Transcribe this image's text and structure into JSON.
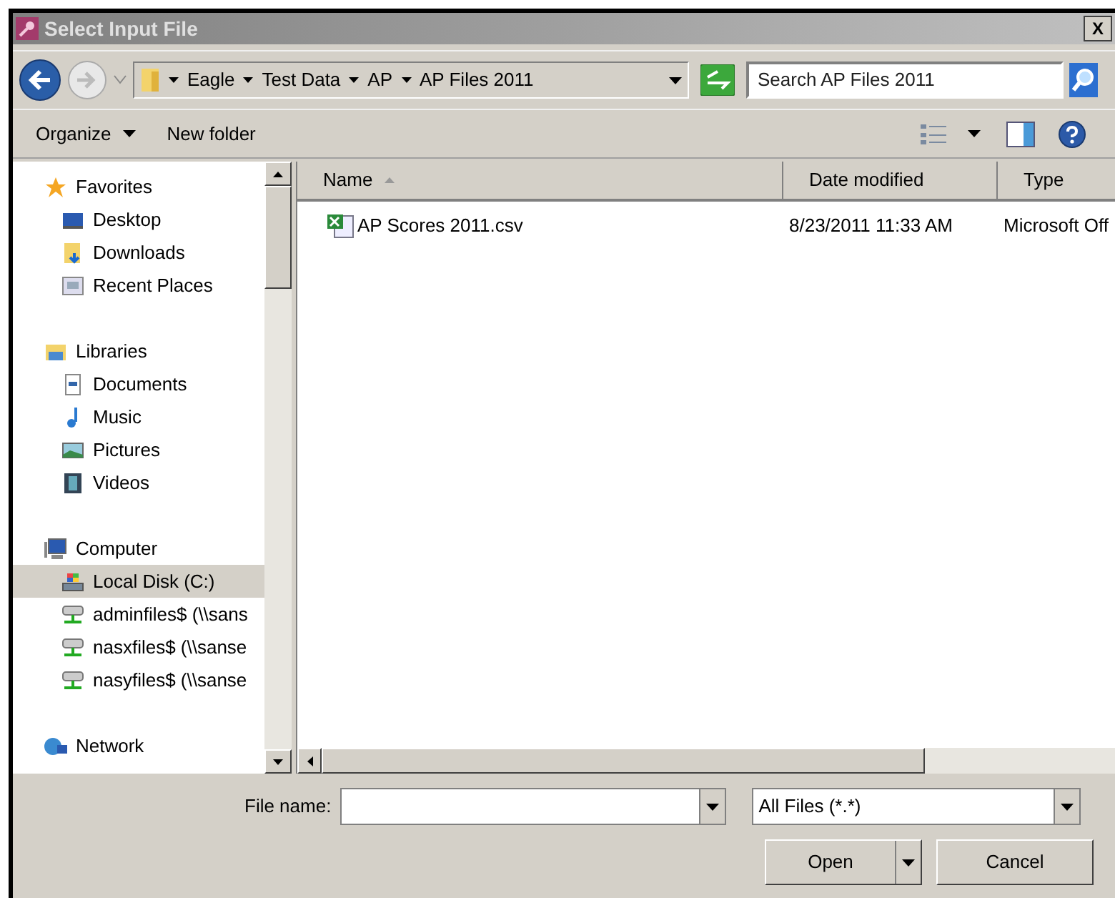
{
  "window": {
    "title": "Select Input File",
    "close_label": "X"
  },
  "address_bar": {
    "breadcrumbs": [
      "Eagle",
      "Test Data",
      "AP",
      "AP Files 2011"
    ]
  },
  "search": {
    "placeholder": "Search AP Files 2011"
  },
  "toolbar": {
    "organize": "Organize",
    "new_folder": "New folder"
  },
  "sidebar": {
    "items": [
      {
        "kind": "header",
        "label": "Favorites",
        "selected": false
      },
      {
        "kind": "item",
        "label": "Desktop",
        "selected": false
      },
      {
        "kind": "item",
        "label": "Downloads",
        "selected": false
      },
      {
        "kind": "item",
        "label": "Recent Places",
        "selected": false
      },
      {
        "kind": "gap"
      },
      {
        "kind": "header",
        "label": "Libraries",
        "selected": false
      },
      {
        "kind": "item",
        "label": "Documents",
        "selected": false
      },
      {
        "kind": "item",
        "label": "Music",
        "selected": false
      },
      {
        "kind": "item",
        "label": "Pictures",
        "selected": false
      },
      {
        "kind": "item",
        "label": "Videos",
        "selected": false
      },
      {
        "kind": "gap"
      },
      {
        "kind": "header",
        "label": "Computer",
        "selected": false
      },
      {
        "kind": "item",
        "label": "Local Disk (C:)",
        "selected": true
      },
      {
        "kind": "item",
        "label": "adminfiles$ (\\\\sans",
        "selected": false
      },
      {
        "kind": "item",
        "label": "nasxfiles$ (\\\\sanse",
        "selected": false
      },
      {
        "kind": "item",
        "label": "nasyfiles$ (\\\\sanse",
        "selected": false
      },
      {
        "kind": "gap"
      },
      {
        "kind": "header",
        "label": "Network",
        "selected": false
      }
    ]
  },
  "table": {
    "columns": [
      {
        "label": "Name",
        "sorted": true
      },
      {
        "label": "Date modified",
        "sorted": false
      },
      {
        "label": "Type",
        "sorted": false
      }
    ],
    "rows": [
      {
        "name": "AP Scores 2011.csv",
        "date_modified": "8/23/2011 11:33 AM",
        "type": "Microsoft Off"
      }
    ]
  },
  "footer": {
    "file_name_label": "File name:",
    "file_type": "All Files (*.*)",
    "open": "Open",
    "cancel": "Cancel"
  }
}
